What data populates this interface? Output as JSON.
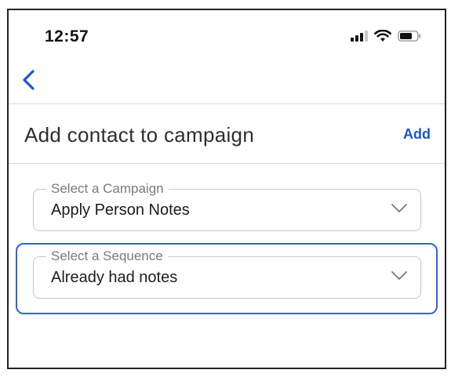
{
  "status_bar": {
    "time": "12:57",
    "signal_icon": "cellular-signal-icon",
    "wifi_icon": "wifi-icon",
    "battery_icon": "battery-icon"
  },
  "nav": {
    "back_icon": "chevron-left-icon"
  },
  "header": {
    "title": "Add contact to campaign",
    "action_label": "Add"
  },
  "form": {
    "campaign": {
      "label": "Select a Campaign",
      "value": "Apply Person Notes"
    },
    "sequence": {
      "label": "Select a Sequence",
      "value": "Already had notes"
    }
  },
  "colors": {
    "accent": "#1a55d6",
    "focus_border": "#2f64d8",
    "divider": "#dcdcdc"
  }
}
